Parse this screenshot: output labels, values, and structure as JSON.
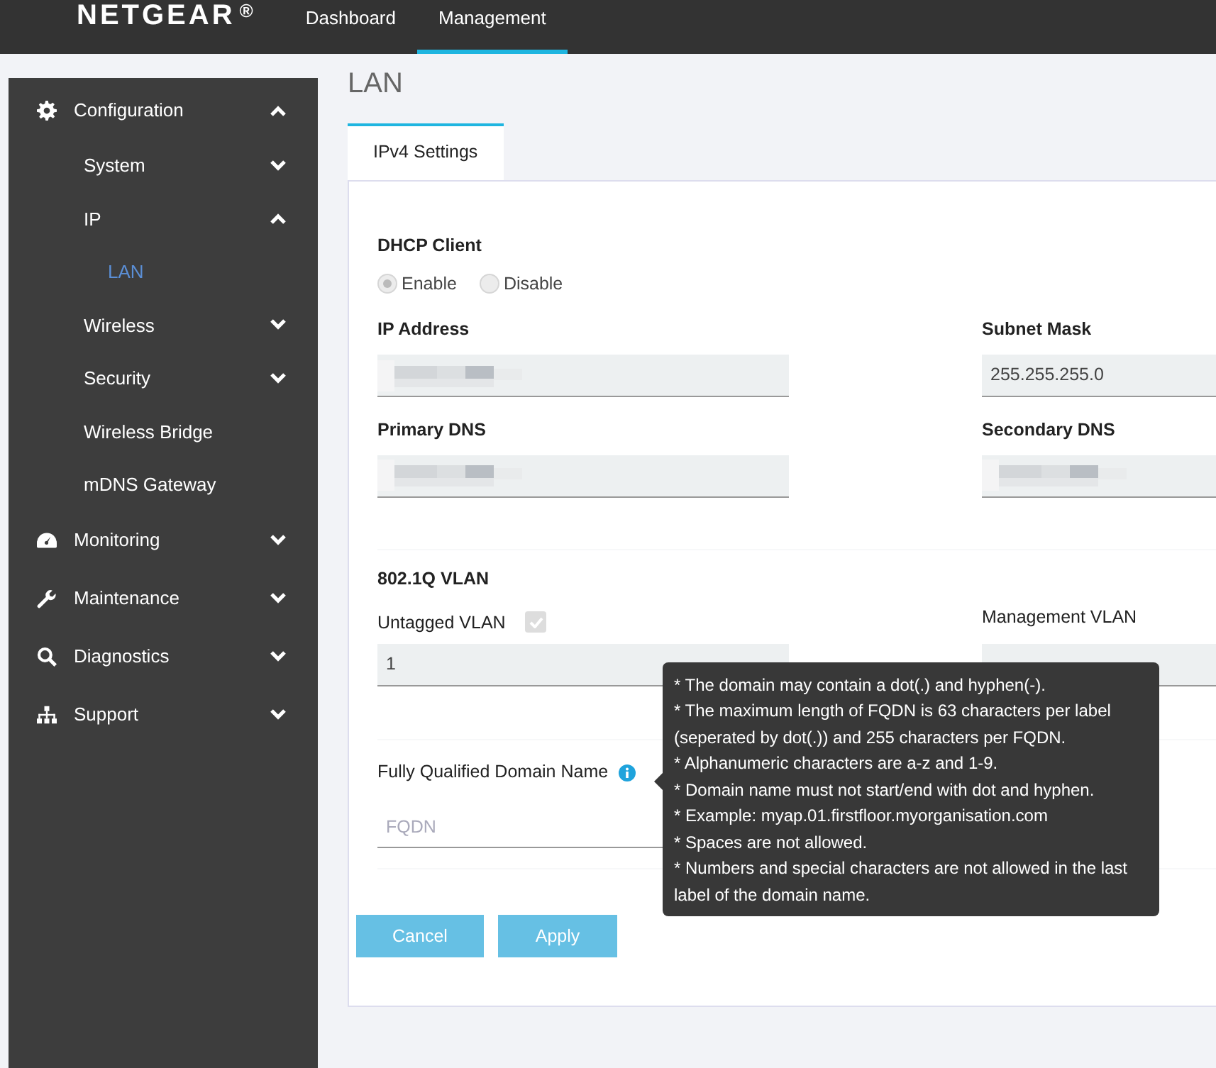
{
  "brand": {
    "name": "NETGEAR",
    "mark": "®"
  },
  "top_nav": [
    {
      "label": "Dashboard",
      "selected": false
    },
    {
      "label": "Management",
      "selected": true
    }
  ],
  "sidebar": {
    "items": [
      {
        "label": "Configuration",
        "expanded": true,
        "selected": false,
        "children": [
          {
            "label": "System",
            "expanded": false,
            "selected": false
          },
          {
            "label": "IP",
            "expanded": true,
            "selected": false,
            "children": [
              {
                "label": "LAN",
                "selected": true
              }
            ]
          },
          {
            "label": "Wireless",
            "expanded": false,
            "selected": false
          },
          {
            "label": "Security",
            "expanded": false,
            "selected": false
          },
          {
            "label": "Wireless Bridge",
            "selected": false
          },
          {
            "label": "mDNS Gateway",
            "selected": false
          }
        ]
      },
      {
        "label": "Monitoring",
        "expanded": false,
        "selected": false
      },
      {
        "label": "Maintenance",
        "expanded": false,
        "selected": false
      },
      {
        "label": "Diagnostics",
        "expanded": false,
        "selected": false
      },
      {
        "label": "Support",
        "expanded": false,
        "selected": false
      }
    ]
  },
  "page_title": "LAN",
  "tabs": [
    {
      "label": "IPv4 Settings",
      "selected": true
    }
  ],
  "dhcp_client": {
    "label": "DHCP Client",
    "disabled": true,
    "options": [
      {
        "label": "Enable",
        "selected": true
      },
      {
        "label": "Disable",
        "selected": false
      }
    ]
  },
  "fields": [
    {
      "label": "IP Address",
      "redacted": true
    },
    {
      "label": "Subnet Mask",
      "value": "255.255.255.0",
      "redacted": false
    },
    {
      "label": "Primary DNS",
      "redacted": true
    },
    {
      "label": "Secondary DNS",
      "redacted": true
    }
  ],
  "vlan": {
    "title": "802.1Q VLAN",
    "untagged": {
      "label": "Untagged VLAN",
      "checked": true,
      "disabled": true,
      "value": "1"
    },
    "management": {
      "label": "Management VLAN"
    }
  },
  "fqdn": {
    "label": "Fully Qualified Domain Name",
    "placeholder": "FQDN"
  },
  "tooltip": {
    "lines": [
      "* The domain may contain a dot(.) and hyphen(-).",
      "* The maximum length of FQDN is 63 characters per label (seperated by dot(.)) and 255 characters per FQDN.",
      "* Alphanumeric characters are a-z and 1-9.",
      "* Domain name must not start/end with dot and hyphen.",
      "* Example: myap.01.firstfloor.myorganisation.com",
      "* Spaces are not allowed.",
      "* Numbers and special characters are not allowed in the last label of the domain name."
    ]
  },
  "buttons": [
    {
      "label": "Cancel"
    },
    {
      "label": "Apply"
    }
  ]
}
